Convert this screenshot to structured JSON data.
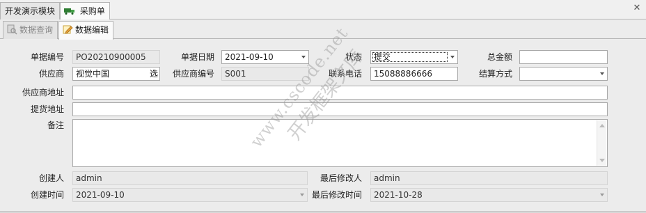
{
  "tabs": [
    {
      "label": "开发演示模块"
    },
    {
      "label": "采购单"
    }
  ],
  "subtabs": [
    {
      "label": "数据查询"
    },
    {
      "label": "数据编辑"
    }
  ],
  "form": {
    "doc_no": {
      "label": "单据编号",
      "value": "PO20210900005"
    },
    "doc_date": {
      "label": "单据日期",
      "value": "2021-09-10"
    },
    "status": {
      "label": "状态",
      "value": "提交"
    },
    "total": {
      "label": "总金额",
      "value": ""
    },
    "supplier": {
      "label": "供应商",
      "value": "视觉中国",
      "pick": "选"
    },
    "supplier_code": {
      "label": "供应商编号",
      "value": "S001"
    },
    "phone": {
      "label": "联系电话",
      "value": "15088886666"
    },
    "settle": {
      "label": "结算方式",
      "value": ""
    },
    "supplier_addr": {
      "label": "供应商地址",
      "value": ""
    },
    "pickup_addr": {
      "label": "提货地址",
      "value": ""
    },
    "remark": {
      "label": "备注",
      "value": ""
    },
    "creator": {
      "label": "创建人",
      "value": "admin"
    },
    "modifier": {
      "label": "最后修改人",
      "value": "admin"
    },
    "create_time": {
      "label": "创建时间",
      "value": "2021-09-10"
    },
    "modify_time": {
      "label": "最后修改时间",
      "value": "2021-10-28"
    }
  },
  "watermark": {
    "line1": "www.cscode.net",
    "line2": "开发框架文库"
  }
}
